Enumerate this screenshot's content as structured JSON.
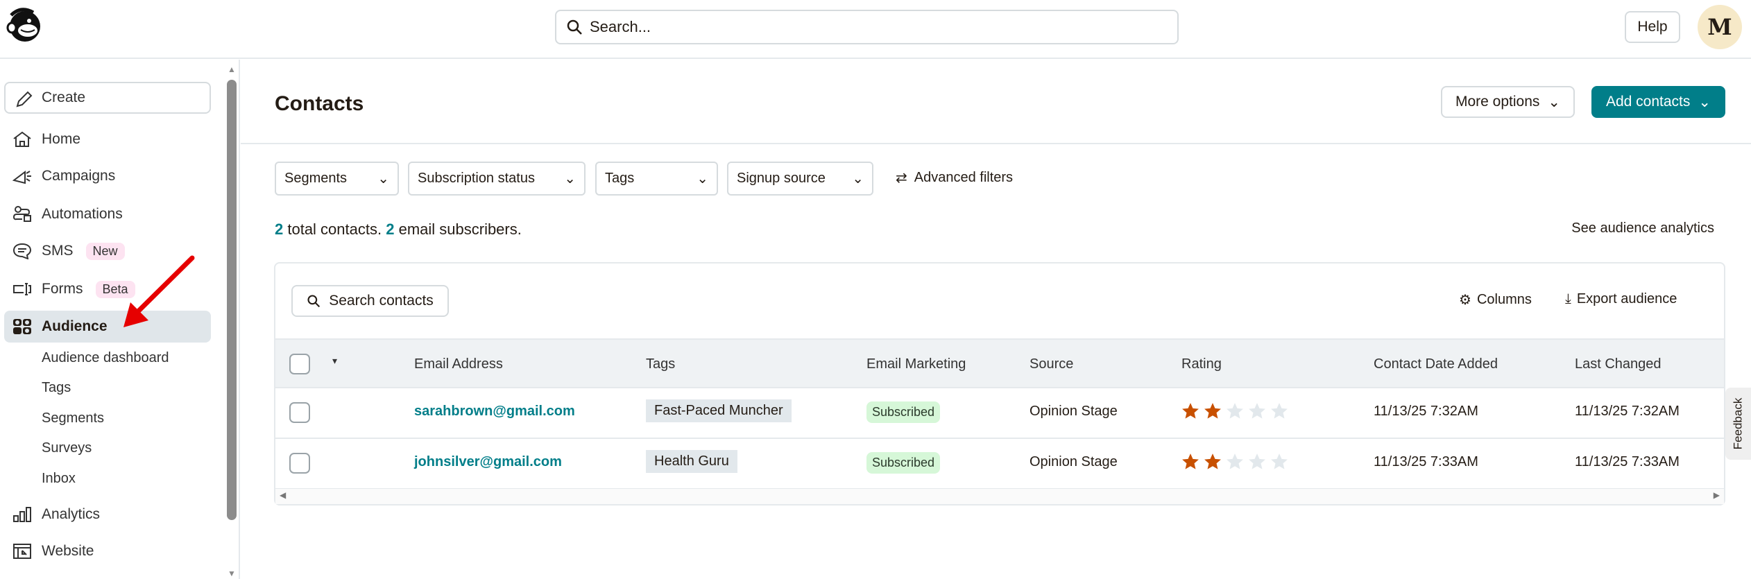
{
  "header": {
    "search_placeholder": "Search...",
    "help": "Help",
    "avatar_initial": "M"
  },
  "sidebar": {
    "create": "Create",
    "items": [
      {
        "label": "Home"
      },
      {
        "label": "Campaigns"
      },
      {
        "label": "Automations"
      },
      {
        "label": "SMS",
        "badge": "New"
      },
      {
        "label": "Forms",
        "badge": "Beta"
      },
      {
        "label": "Audience"
      }
    ],
    "audience_sub": [
      "Audience dashboard",
      "Tags",
      "Segments",
      "Surveys",
      "Inbox"
    ],
    "bottom_items": [
      "Analytics",
      "Website"
    ]
  },
  "page": {
    "title": "Contacts",
    "more_options": "More options",
    "add_contacts": "Add contacts"
  },
  "filters": [
    "Segments",
    "Subscription status",
    "Tags",
    "Signup source"
  ],
  "advanced_filters": "Advanced filters",
  "summary": {
    "total": "2",
    "total_label": " total contacts. ",
    "subs": "2",
    "subs_label": " email subscribers."
  },
  "see_analytics": "See audience analytics",
  "table": {
    "search": "Search contacts",
    "columns_btn": "Columns",
    "export": "Export audience",
    "headers": [
      "Email Address",
      "Tags",
      "Email Marketing",
      "Source",
      "Rating",
      "Contact Date Added",
      "Last Changed"
    ],
    "rows": [
      {
        "email": "sarahbrown@gmail.com",
        "tag": "Fast-Paced Muncher",
        "status": "Subscribed",
        "source": "Opinion Stage",
        "rating": 2,
        "added": "11/13/25 7:32AM",
        "changed": "11/13/25 7:32AM"
      },
      {
        "email": "johnsilver@gmail.com",
        "tag": "Health Guru",
        "status": "Subscribed",
        "source": "Opinion Stage",
        "rating": 2,
        "added": "11/13/25 7:33AM",
        "changed": "11/13/25 7:33AM"
      }
    ]
  },
  "feedback": "Feedback",
  "colors": {
    "accent": "#017e89",
    "star": "#c85000",
    "star_empty": "#e2e8ec"
  }
}
